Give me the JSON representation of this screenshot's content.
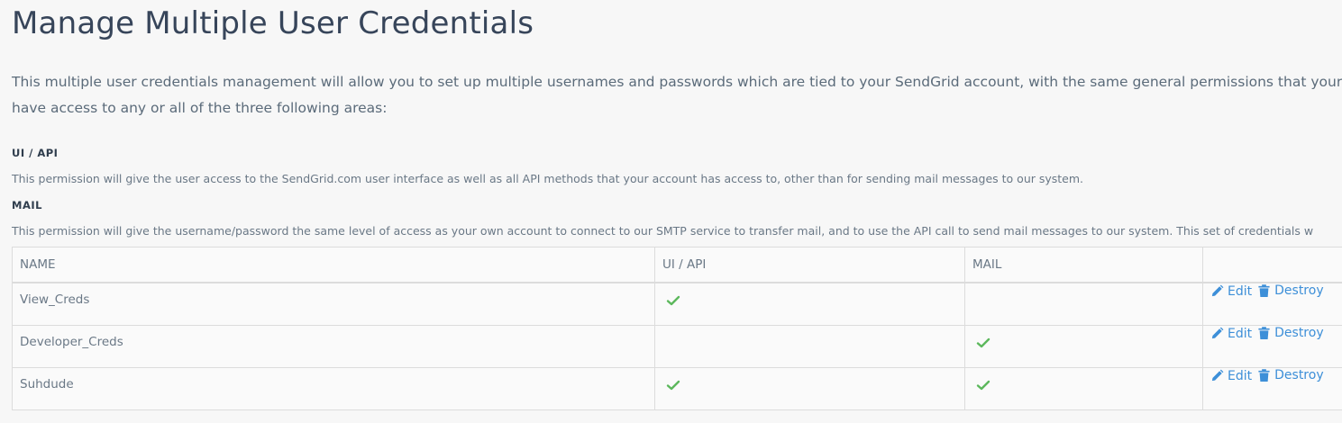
{
  "title": "Manage Multiple User Credentials",
  "intro": {
    "line1": "This multiple user credentials management will allow you to set up multiple usernames and passwords which are tied to your SendGrid account, with the same general permissions that your ac",
    "line2": "have access to any or all of the three following areas:"
  },
  "permissions": [
    {
      "heading": "UI / API",
      "description": "This permission will give the user access to the SendGrid.com user interface as well as all API methods that your account has access to, other than for sending mail messages to our system."
    },
    {
      "heading": "MAIL",
      "description": "This permission will give the username/password the same level of access as your own account to connect to our SMTP service to transfer mail, and to use the API call to send mail messages to our system. This set of credentials w"
    }
  ],
  "table": {
    "headers": [
      "NAME",
      "UI / API",
      "MAIL",
      ""
    ],
    "rows": [
      {
        "name": "View_Creds",
        "ui_api": true,
        "mail": false
      },
      {
        "name": "Developer_Creds",
        "ui_api": false,
        "mail": true
      },
      {
        "name": "Suhdude",
        "ui_api": true,
        "mail": true
      }
    ],
    "edit_label": "Edit",
    "destroy_label": "Destroy"
  },
  "icons": {
    "check": "check-icon",
    "edit": "pencil-icon",
    "destroy": "trash-icon"
  },
  "colors": {
    "check": "#5cb85c",
    "link": "#3d8fd8",
    "title": "#37455a"
  }
}
